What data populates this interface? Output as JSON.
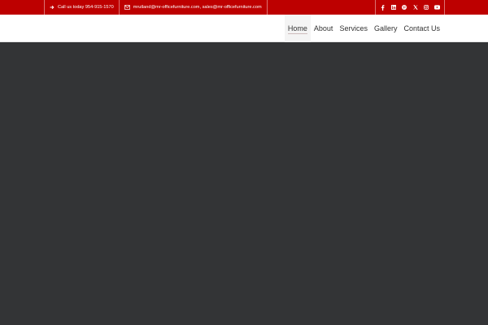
{
  "topbar": {
    "phone_text": "Call us today 954-915-1570",
    "phone_icon": "arrow-right-icon",
    "email_text": "mrutland@mr-officefurniture.com, sales@mr-officefurniture.com",
    "email_icon": "envelope-icon",
    "social": [
      {
        "name": "facebook-icon"
      },
      {
        "name": "linkedin-icon"
      },
      {
        "name": "pinterest-icon"
      },
      {
        "name": "x-twitter-icon"
      },
      {
        "name": "instagram-icon"
      },
      {
        "name": "youtube-icon"
      }
    ]
  },
  "nav": {
    "items": [
      {
        "label": "Home",
        "active": true
      },
      {
        "label": "About",
        "active": false
      },
      {
        "label": "Services",
        "active": false
      },
      {
        "label": "Gallery",
        "active": false
      },
      {
        "label": "Contact Us",
        "active": false
      }
    ]
  },
  "colors": {
    "topbar": "#bd0000",
    "hero": "#333436",
    "header": "#ffffff"
  }
}
